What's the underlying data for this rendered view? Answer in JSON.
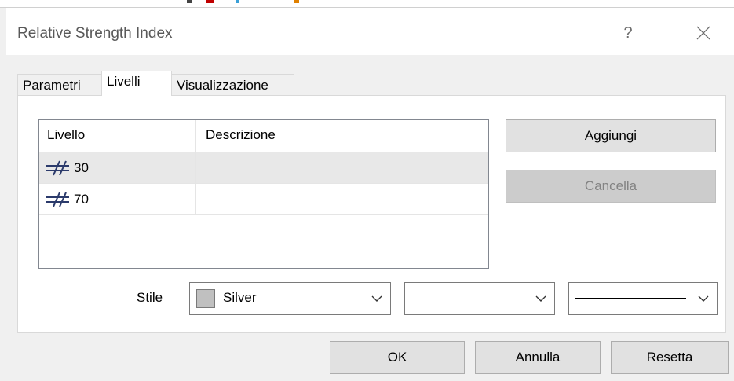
{
  "dialog": {
    "title": "Relative Strength Index",
    "help_label": "?"
  },
  "tabs": [
    {
      "label": "Parametri",
      "active": false
    },
    {
      "label": "Livelli",
      "active": true
    },
    {
      "label": "Visualizzazione",
      "active": false
    }
  ],
  "levels_table": {
    "columns": [
      "Livello",
      "Descrizione"
    ],
    "rows": [
      {
        "level": "30",
        "description": "",
        "selected": true
      },
      {
        "level": "70",
        "description": "",
        "selected": false
      }
    ]
  },
  "buttons": {
    "add": "Aggiungi",
    "delete": "Cancella"
  },
  "style": {
    "label": "Stile",
    "color_name": "Silver",
    "color_hex": "#c0c0c0"
  },
  "footer": {
    "ok": "OK",
    "cancel": "Annulla",
    "reset": "Resetta"
  },
  "icons": {
    "level_icon": "not-equal-level-icon",
    "chevron": "chevron-down-icon",
    "close": "close-icon"
  }
}
